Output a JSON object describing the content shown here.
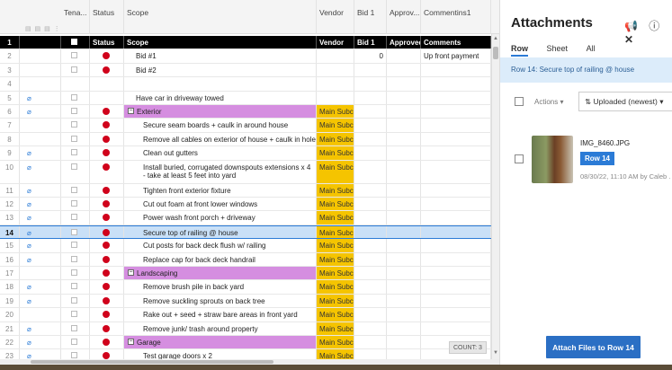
{
  "grid": {
    "column_headers": [
      "Tena...",
      "Status",
      "Scope",
      "Vendor",
      "Bid 1",
      "Approv...",
      "Commentins1"
    ],
    "header_row": {
      "num": "1",
      "status": "Status",
      "scope": "Scope",
      "vendor": "Vendor",
      "bid1": "Bid 1",
      "approved": "Approved",
      "comments": "Comments"
    },
    "rows": [
      {
        "num": "2",
        "check": true,
        "status": "red",
        "attach": false,
        "scope": "Bid #1",
        "indent": 1,
        "group": false,
        "vendor": "",
        "bid1": "0",
        "approved": "",
        "comments": "Up front payment"
      },
      {
        "num": "3",
        "check": true,
        "status": "red",
        "attach": false,
        "scope": "Bid #2",
        "indent": 1,
        "group": false,
        "vendor": "",
        "bid1": "",
        "approved": "",
        "comments": ""
      },
      {
        "num": "4",
        "check": false,
        "status": "",
        "attach": false,
        "scope": "",
        "indent": 1,
        "group": false,
        "vendor": "",
        "bid1": "",
        "approved": "",
        "comments": ""
      },
      {
        "num": "5",
        "check": true,
        "status": "",
        "attach": true,
        "scope": "Have car in driveway towed",
        "indent": 1,
        "group": false,
        "vendor": "",
        "bid1": "",
        "approved": "",
        "comments": ""
      },
      {
        "num": "6",
        "check": true,
        "status": "red",
        "attach": true,
        "scope": "Exterior",
        "indent": 0,
        "group": true,
        "vendor": "Main Subcc",
        "bid1": "",
        "approved": "",
        "comments": ""
      },
      {
        "num": "7",
        "check": true,
        "status": "red",
        "attach": false,
        "scope": "Secure seam boards + caulk in around house",
        "indent": 2,
        "group": false,
        "vendor": "Main Subcc",
        "bid1": "",
        "approved": "",
        "comments": ""
      },
      {
        "num": "8",
        "check": true,
        "status": "red",
        "attach": false,
        "scope": "Remove all cables on exterior of house + caulk in holes",
        "indent": 2,
        "group": false,
        "vendor": "Main Subcc",
        "bid1": "",
        "approved": "",
        "comments": ""
      },
      {
        "num": "9",
        "check": true,
        "status": "red",
        "attach": true,
        "scope": "Clean out gutters",
        "indent": 2,
        "group": false,
        "vendor": "Main Subcc",
        "bid1": "",
        "approved": "",
        "comments": ""
      },
      {
        "num": "10",
        "check": true,
        "status": "red",
        "attach": true,
        "scope": "Install buried, corrugated downspouts extensions x 4 - take at least 5 feet into yard",
        "indent": 2,
        "group": false,
        "tall": true,
        "vendor": "Main Subcc",
        "bid1": "",
        "approved": "",
        "comments": ""
      },
      {
        "num": "11",
        "check": true,
        "status": "red",
        "attach": true,
        "scope": "Tighten front exterior fixture",
        "indent": 2,
        "group": false,
        "vendor": "Main Subcc",
        "bid1": "",
        "approved": "",
        "comments": ""
      },
      {
        "num": "12",
        "check": true,
        "status": "red",
        "attach": true,
        "scope": "Cut out foam at front lower windows",
        "indent": 2,
        "group": false,
        "vendor": "Main Subcc",
        "bid1": "",
        "approved": "",
        "comments": ""
      },
      {
        "num": "13",
        "check": true,
        "status": "red",
        "attach": true,
        "scope": "Power wash front porch + driveway",
        "indent": 2,
        "group": false,
        "vendor": "Main Subcc",
        "bid1": "",
        "approved": "",
        "comments": ""
      },
      {
        "num": "14",
        "check": true,
        "status": "red",
        "attach": true,
        "scope": "Secure top of railing @ house",
        "indent": 2,
        "group": false,
        "selected": true,
        "vendor": "Main Subcc",
        "bid1": "",
        "approved": "",
        "comments": ""
      },
      {
        "num": "15",
        "check": true,
        "status": "red",
        "attach": true,
        "scope": "Cut posts for back deck flush w/ railing",
        "indent": 2,
        "group": false,
        "vendor": "Main Subcc",
        "bid1": "",
        "approved": "",
        "comments": ""
      },
      {
        "num": "16",
        "check": true,
        "status": "red",
        "attach": true,
        "scope": "Replace cap for back deck handrail",
        "indent": 2,
        "group": false,
        "vendor": "Main Subcc",
        "bid1": "",
        "approved": "",
        "comments": ""
      },
      {
        "num": "17",
        "check": true,
        "status": "red",
        "attach": false,
        "scope": "Landscaping",
        "indent": 0,
        "group": true,
        "vendor": "Main Subcc",
        "bid1": "",
        "approved": "",
        "comments": ""
      },
      {
        "num": "18",
        "check": true,
        "status": "red",
        "attach": true,
        "scope": "Remove brush pile in back yard",
        "indent": 2,
        "group": false,
        "vendor": "Main Subcc",
        "bid1": "",
        "approved": "",
        "comments": ""
      },
      {
        "num": "19",
        "check": true,
        "status": "red",
        "attach": true,
        "scope": "Remove suckling sprouts on back tree",
        "indent": 2,
        "group": false,
        "vendor": "Main Subcc",
        "bid1": "",
        "approved": "",
        "comments": ""
      },
      {
        "num": "20",
        "check": true,
        "status": "red",
        "attach": false,
        "scope": "Rake out + seed + straw bare areas in front yard",
        "indent": 2,
        "group": false,
        "vendor": "Main Subcc",
        "bid1": "",
        "approved": "",
        "comments": ""
      },
      {
        "num": "21",
        "check": true,
        "status": "red",
        "attach": true,
        "scope": "Remove junk/ trash around property",
        "indent": 2,
        "group": false,
        "vendor": "Main Subcc",
        "bid1": "",
        "approved": "",
        "comments": ""
      },
      {
        "num": "22",
        "check": true,
        "status": "red",
        "attach": true,
        "scope": "Garage",
        "indent": 0,
        "group": true,
        "vendor": "Main Subcc",
        "bid1": "",
        "approved": "",
        "comments": ""
      },
      {
        "num": "23",
        "check": true,
        "status": "red",
        "attach": true,
        "scope": "Test garage doors x 2",
        "indent": 2,
        "group": false,
        "vendor": "Main Subcc",
        "bid1": "",
        "approved": "",
        "comments": ""
      }
    ],
    "count_label": "COUNT: 3"
  },
  "panel": {
    "title": "Attachments",
    "tabs": [
      "Row",
      "Sheet",
      "All"
    ],
    "active_tab": "Row",
    "banner": "Row 14: Secure top of railing @ house",
    "actions_label": "Actions",
    "sort_label": "Uploaded (newest)",
    "attachment": {
      "name": "IMG_8460.JPG",
      "badge": "Row 14",
      "meta": "08/30/22, 11:10 AM by Caleb ..."
    },
    "attach_button": "Attach Files to Row 14"
  },
  "colors": {
    "status_red": "#d0021b",
    "group_purple": "#d58ee0",
    "vendor_yellow": "#f5c400",
    "accent_blue": "#2b7bd6"
  }
}
